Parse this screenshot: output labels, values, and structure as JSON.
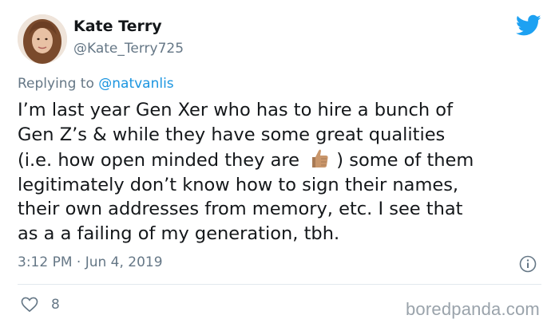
{
  "tweet": {
    "display_name": "Kate Terry",
    "handle": "@Kate_Terry725",
    "reply_prefix": "Replying to",
    "reply_to": "@natvanlis",
    "text_lines": [
      "I’m last year Gen Xer who has to hire a bunch of",
      "Gen Z’s & while they have some great qualities",
      "(i.e. how open minded they are",
      ") some of them",
      "legitimately don’t know how to sign their names,",
      "their own addresses from memory, etc. I see that",
      "as a a failing of my generation, tbh."
    ],
    "emoji": "thumbs-up",
    "timestamp": "3:12 PM · Jun 4, 2019",
    "like_count": "8"
  },
  "brand": {
    "twitter_color": "#1da1f2",
    "watermark": "boredpanda.com"
  },
  "icons": [
    "twitter-logo-icon",
    "thumbs-up-icon",
    "info-icon",
    "heart-icon"
  ]
}
